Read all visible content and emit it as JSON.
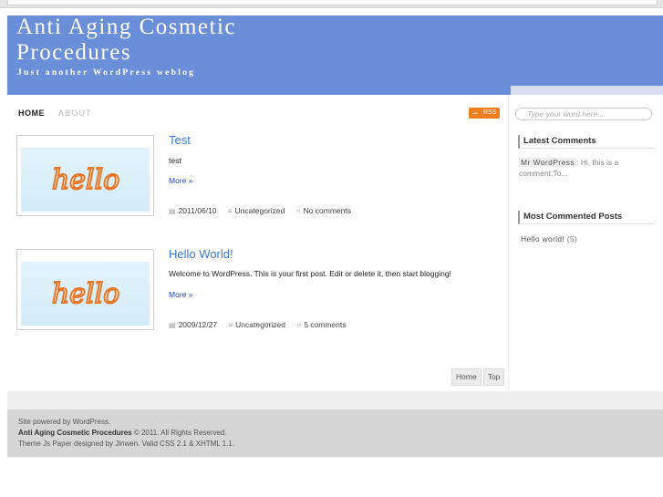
{
  "header": {
    "title": "Anti Aging Cosmetic Procedures",
    "tagline": "Just another WordPress weblog"
  },
  "nav": [
    {
      "label": "HOME",
      "active": true
    },
    {
      "label": "ABOUT",
      "active": false
    }
  ],
  "rss": {
    "label": "RSS"
  },
  "search": {
    "placeholder": "Type your word here..."
  },
  "posts": [
    {
      "title": "Test",
      "excerpt": "test",
      "more": "More »",
      "date": "2011/06/10",
      "category": "Uncategorized",
      "comments": "No comments",
      "thumbnail_text": "hello"
    },
    {
      "title": "Hello World!",
      "excerpt": "Welcome to WordPress. This is your first post. Edit or delete it, then start blogging!",
      "more": "More »",
      "date": "2009/12/27",
      "category": "Uncategorized",
      "comments": "5 comments",
      "thumbnail_text": "hello"
    }
  ],
  "pager": {
    "home": "Home",
    "top": "Top"
  },
  "sidebar": {
    "latest_comments": {
      "title": "Latest Comments",
      "author": "Mr WordPress",
      "excerpt": ": Hi, this is a comment.To..."
    },
    "most_commented": {
      "title": "Most Commented Posts",
      "item": "Hello world!",
      "count": "(5)"
    }
  },
  "footer": {
    "line1": "Site powered by WordPress.",
    "line2_bold": "Anti Aging Cosmetic Procedures",
    "line2_rest": "© 2011. All Rights Reserved.",
    "line3": "Theme Js Paper designed by Jinwen. Valid CSS 2.1 & XHTML 1.1."
  },
  "colors": {
    "header_blue": "#6a8fd8",
    "link_blue": "#3a7ad6",
    "rss_orange": "#f07d1e",
    "thumb_text_orange": "#e8772a"
  }
}
